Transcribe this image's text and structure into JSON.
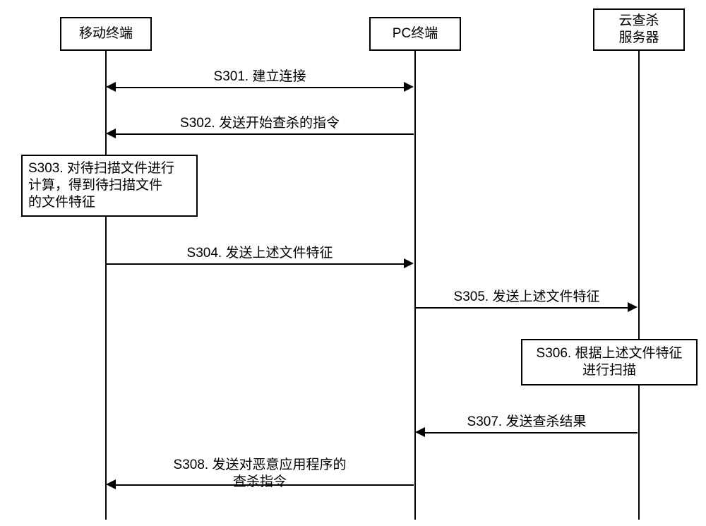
{
  "participants": {
    "mobile": "移动终端",
    "pc": "PC终端",
    "cloud": "云查杀\n服务器"
  },
  "messages": {
    "s301": "S301. 建立连接",
    "s302": "S302. 发送开始查杀的指令",
    "s303": "S303. 对待扫描文件进行\n计算，得到待扫描文件\n的文件特征",
    "s304": "S304. 发送上述文件特征",
    "s305": "S305. 发送上述文件特征",
    "s306": "S306. 根据上述文件特征\n进行扫描",
    "s307": "S307. 发送查杀结果",
    "s308": "S308. 发送对恶意应用程序的\n查杀指令"
  },
  "chart_data": {
    "type": "sequence-diagram",
    "participants": [
      {
        "id": "mobile",
        "label": "移动终端"
      },
      {
        "id": "pc",
        "label": "PC终端"
      },
      {
        "id": "cloud",
        "label": "云查杀服务器"
      }
    ],
    "steps": [
      {
        "id": "S301",
        "from": "mobile",
        "to": "pc",
        "direction": "both",
        "label": "建立连接"
      },
      {
        "id": "S302",
        "from": "pc",
        "to": "mobile",
        "direction": "left",
        "label": "发送开始查杀的指令"
      },
      {
        "id": "S303",
        "at": "mobile",
        "kind": "self-action",
        "label": "对待扫描文件进行计算，得到待扫描文件的文件特征"
      },
      {
        "id": "S304",
        "from": "mobile",
        "to": "pc",
        "direction": "right",
        "label": "发送上述文件特征"
      },
      {
        "id": "S305",
        "from": "pc",
        "to": "cloud",
        "direction": "right",
        "label": "发送上述文件特征"
      },
      {
        "id": "S306",
        "at": "cloud",
        "kind": "self-action",
        "label": "根据上述文件特征进行扫描"
      },
      {
        "id": "S307",
        "from": "cloud",
        "to": "pc",
        "direction": "left",
        "label": "发送查杀结果"
      },
      {
        "id": "S308",
        "from": "pc",
        "to": "mobile",
        "direction": "left",
        "label": "发送对恶意应用程序的查杀指令"
      }
    ]
  }
}
